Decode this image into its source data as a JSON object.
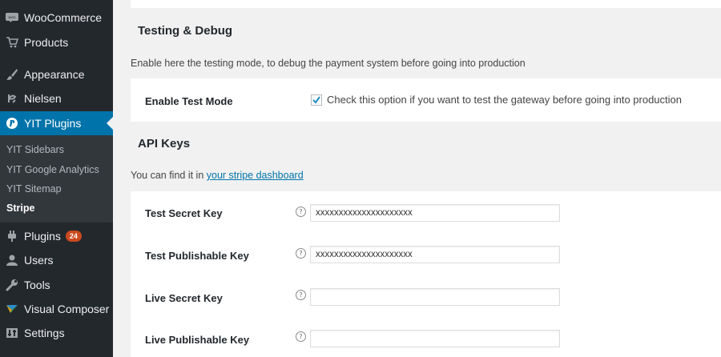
{
  "sidebar": {
    "menu": [
      {
        "label": "WooCommerce",
        "icon": "woocommerce-icon"
      },
      {
        "label": "Products",
        "icon": "cart-icon"
      },
      {
        "label": "Appearance",
        "icon": "paintbrush-icon"
      },
      {
        "label": "Nielsen",
        "icon": "nielsen-icon"
      },
      {
        "label": "YIT Plugins",
        "icon": "yit-icon"
      },
      {
        "label": "Plugins",
        "icon": "plugin-icon",
        "badge": "24"
      },
      {
        "label": "Users",
        "icon": "user-icon"
      },
      {
        "label": "Tools",
        "icon": "wrench-icon"
      },
      {
        "label": "Visual Composer",
        "icon": "visual-composer-icon"
      },
      {
        "label": "Settings",
        "icon": "settings-icon"
      }
    ],
    "submenu": [
      {
        "label": "YIT Sidebars"
      },
      {
        "label": "YIT Google Analytics"
      },
      {
        "label": "YIT Sitemap"
      },
      {
        "label": "Stripe"
      }
    ],
    "active_item": "YIT Plugins",
    "current_subitem": "Stripe"
  },
  "testing": {
    "title": "Testing & Debug",
    "description": "Enable here the testing mode, to debug the payment system before going into production",
    "test_mode_label": "Enable Test Mode",
    "test_mode_checked": true,
    "test_mode_desc": "Check this option if you want to test the gateway before going into production"
  },
  "api": {
    "title": "API Keys",
    "description_prefix": "You can find it in ",
    "description_link": "your stripe dashboard",
    "fields": [
      {
        "label": "Test Secret Key",
        "value": "xxxxxxxxxxxxxxxxxxxxx"
      },
      {
        "label": "Test Publishable Key",
        "value": "xxxxxxxxxxxxxxxxxxxxx"
      },
      {
        "label": "Live Secret Key",
        "value": ""
      },
      {
        "label": "Live Publishable Key",
        "value": ""
      }
    ]
  },
  "help_glyph": "?",
  "colors": {
    "sidebar_bg": "#23282d",
    "submenu_bg": "#32373c",
    "active_bg": "#0073aa",
    "badge_bg": "#ca4a1f",
    "link": "#0073aa"
  }
}
